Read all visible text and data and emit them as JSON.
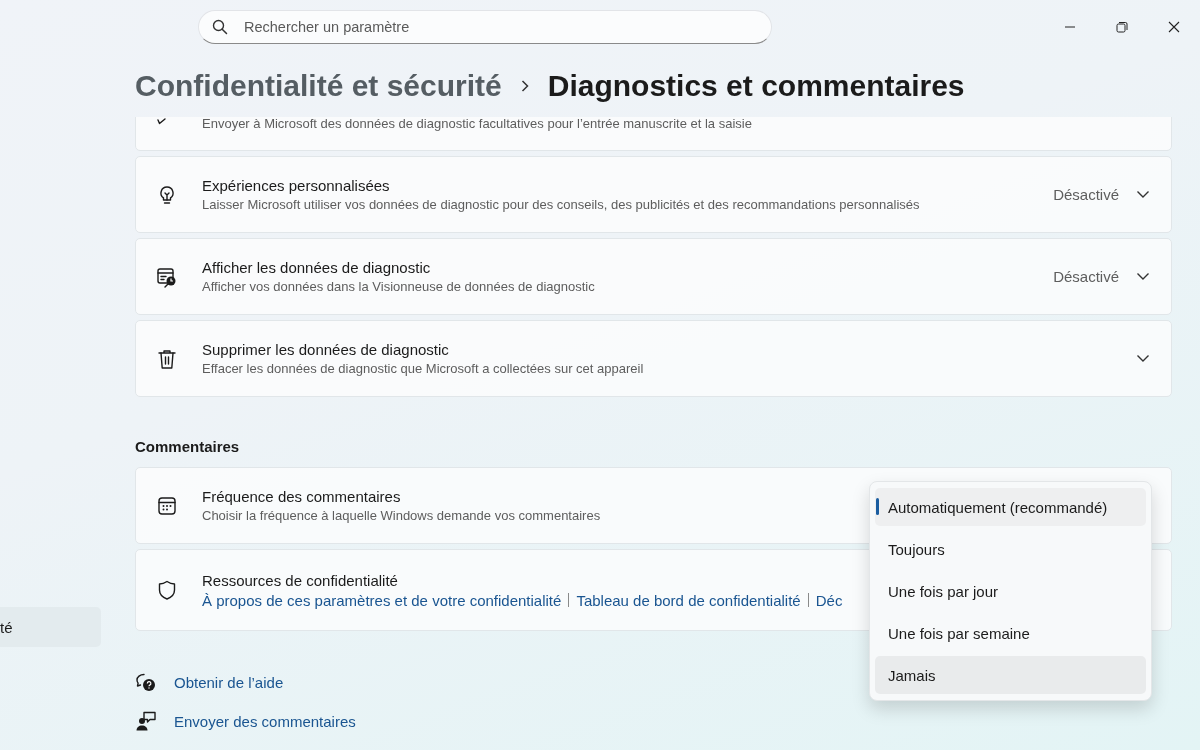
{
  "search": {
    "placeholder": "Rechercher un paramètre"
  },
  "sidebar": {
    "items": [
      {
        "label": "té",
        "selected": true
      }
    ]
  },
  "breadcrumb": {
    "parent": "Confidentialité et sécurité",
    "current": "Diagnostics et commentaires"
  },
  "sections": [
    {
      "cards": [
        {
          "description": "Envoyer à Microsoft des données de diagnostic facultatives pour l’entrée manuscrite et la saisie"
        },
        {
          "title": "Expériences personnalisées",
          "description": "Laisser Microsoft utiliser vos données de diagnostic pour des conseils, des publicités et des recommandations personnalisés",
          "status": "Désactivé",
          "expandable": true
        },
        {
          "title": "Afficher les données de diagnostic",
          "description": "Afficher vos données dans la Visionneuse de données de diagnostic",
          "status": "Désactivé",
          "expandable": true
        },
        {
          "title": "Supprimer les données de diagnostic",
          "description": "Effacer les données de diagnostic que Microsoft a collectées sur cet appareil",
          "expandable": true
        }
      ]
    },
    {
      "heading": "Commentaires",
      "cards": [
        {
          "title": "Fréquence des commentaires",
          "description": "Choisir la fréquence à laquelle Windows demande vos commentaires",
          "dropdown": {
            "options": [
              {
                "label": "Automatiquement (recommandé)",
                "selected": true,
                "highlighted": false
              },
              {
                "label": "Toujours",
                "selected": false,
                "highlighted": false
              },
              {
                "label": "Une fois par jour",
                "selected": false,
                "highlighted": false
              },
              {
                "label": "Une fois par semaine",
                "selected": false,
                "highlighted": false
              },
              {
                "label": "Jamais",
                "selected": false,
                "highlighted": true
              }
            ]
          }
        },
        {
          "title": "Ressources de confidentialité",
          "links": [
            "À propos de ces paramètres et de votre confidentialité",
            "Tableau de bord de confidentialité",
            "Déc"
          ]
        }
      ]
    }
  ],
  "footer_links": [
    {
      "label": "Obtenir de l’aide"
    },
    {
      "label": "Envoyer des commentaires"
    }
  ]
}
